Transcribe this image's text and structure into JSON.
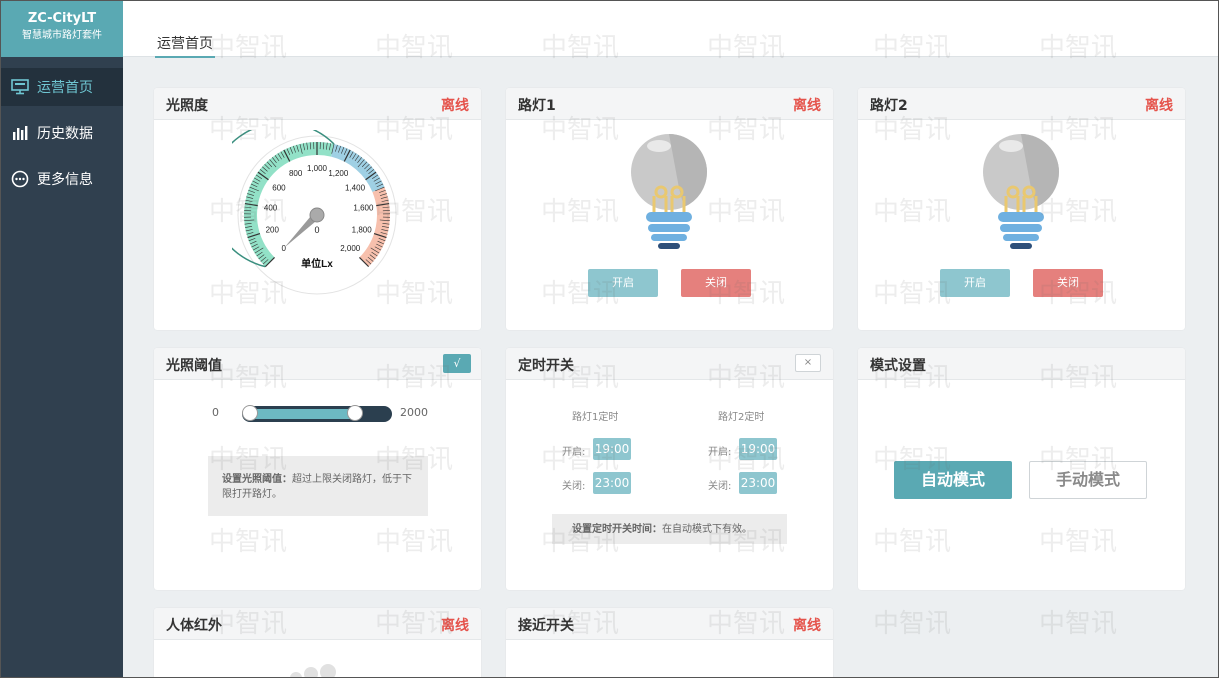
{
  "brand": {
    "title": "ZC-CityLT",
    "subtitle": "智慧城市路灯套件"
  },
  "nav": [
    {
      "label": "运营首页",
      "icon": "monitor-icon"
    },
    {
      "label": "历史数据",
      "icon": "bar-chart-icon"
    },
    {
      "label": "更多信息",
      "icon": "more-icon"
    }
  ],
  "tab": "运营首页",
  "watermark": "中智讯",
  "status_offline": "离线",
  "cards": {
    "light_level": {
      "title": "光照度",
      "gauge": {
        "ticks": [
          "0",
          "200",
          "400",
          "600",
          "800",
          "1,000",
          "1,200",
          "1,400",
          "1,600",
          "1,800",
          "2,000"
        ],
        "value": 0,
        "value_label": "0",
        "unit": "单位Lx",
        "min": 0,
        "max": 2000
      }
    },
    "lamp1": {
      "title": "路灯1",
      "on_label": "开启",
      "off_label": "关闭"
    },
    "lamp2": {
      "title": "路灯2",
      "on_label": "开启",
      "off_label": "关闭"
    },
    "threshold": {
      "title": "光照阈值",
      "confirm_label": "√",
      "min": "0",
      "max": "2000",
      "range_low_fraction": 0.0,
      "range_high_fraction": 0.78,
      "note_bold": "设置光照阈值：",
      "note_text": "超过上限关闭路灯，低于下限打开路灯。"
    },
    "timer": {
      "title": "定时开关",
      "close_label": "×",
      "lamp1_head": "路灯1定时",
      "lamp2_head": "路灯2定时",
      "on_label": "开启:",
      "off_label": "关闭:",
      "lamp1_on": "19:00",
      "lamp1_off": "23:00",
      "lamp2_on": "19:00",
      "lamp2_off": "23:00",
      "note_bold": "设置定时开关时间：",
      "note_text": "在自动模式下有效。"
    },
    "mode": {
      "title": "模式设置",
      "auto_label": "自动模式",
      "manual_label": "手动模式"
    },
    "pir": {
      "title": "人体红外"
    },
    "proximity": {
      "title": "接近开关"
    }
  },
  "colors": {
    "accent": "#5aa9b3",
    "sidebar": "#30404f",
    "offline": "#e5534b",
    "btn_on": "#8ec6cf",
    "btn_off": "#e5807d"
  }
}
